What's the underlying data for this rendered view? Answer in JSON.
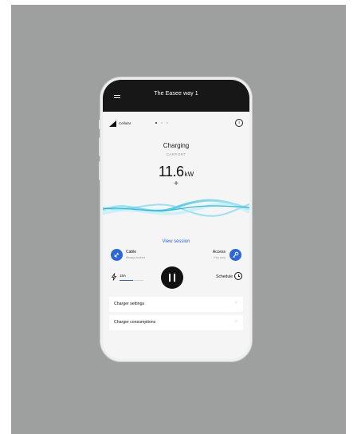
{
  "header": {
    "title": "The Easee way 1",
    "menu_icon": "hamburger-menu-icon"
  },
  "status": {
    "connection": "Cellular",
    "signal_icon": "signal-icon",
    "info_icon": "info-icon",
    "page_dots": 3,
    "active_dot": 0
  },
  "charger": {
    "state": "Charging",
    "location": "CARPORT",
    "power_value": "11.6",
    "power_unit": "kW",
    "expand_symbol": "+"
  },
  "session": {
    "view_session_label": "View session"
  },
  "cable": {
    "label": "Cable",
    "sub": "Always locked",
    "icon": "cable-lock-icon"
  },
  "access": {
    "label": "Access",
    "sub": "Key only",
    "icon": "key-icon"
  },
  "current": {
    "label": "18A",
    "icon": "lightning-icon",
    "level_fraction": 0.55
  },
  "pause": {
    "icon": "pause-icon"
  },
  "schedule": {
    "label": "Schedule",
    "icon": "clock-icon"
  },
  "list": [
    {
      "label": "Charger settings",
      "icon": "chevron-right-icon"
    },
    {
      "label": "Charger consumptions",
      "icon": "chevron-right-icon"
    }
  ],
  "colors": {
    "accent": "#2b67d9",
    "background": "#9ea0a0",
    "topbar": "#171717"
  }
}
